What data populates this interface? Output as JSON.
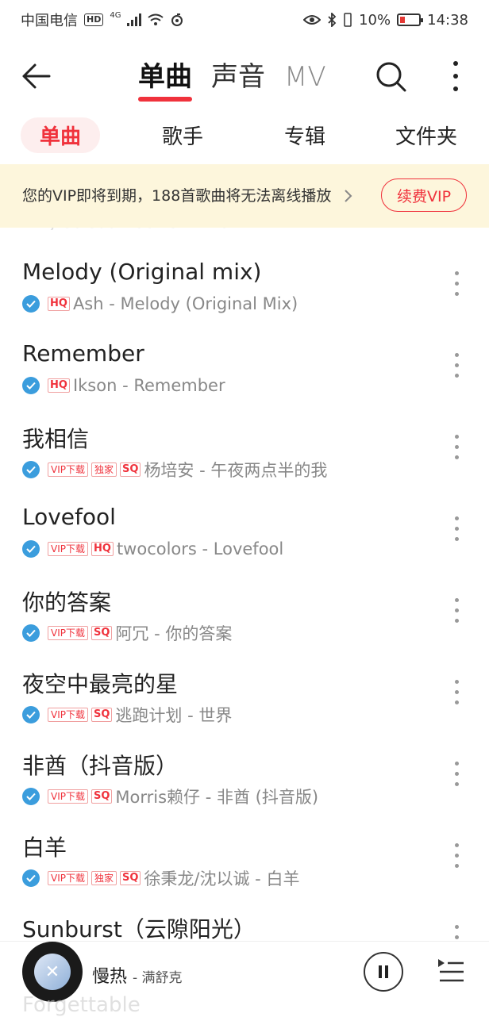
{
  "status_bar": {
    "carrier": "中国电信",
    "hd": "HD",
    "network": "4G",
    "battery_pct": "10%",
    "time": "14:38"
  },
  "top_nav": {
    "tabs": [
      "单曲",
      "声音",
      "MV"
    ],
    "active_tab": 0
  },
  "sub_tabs": {
    "items": [
      "单曲",
      "歌手",
      "专辑",
      "文件夹"
    ],
    "active": 0
  },
  "banner": {
    "text": "您的VIP即将到期，188首歌曲将无法离线播放",
    "button": "续费VIP"
  },
  "partial_row": {
    "text": "Why So Sad - Out Of Time"
  },
  "songs": [
    {
      "title": "Melody (Original mix)",
      "badges": [
        "HQ"
      ],
      "meta": "Ash - Melody (Original Mix)"
    },
    {
      "title": "Remember",
      "badges": [
        "HQ"
      ],
      "meta": "Ikson - Remember"
    },
    {
      "title": "我相信",
      "badges": [
        "VIP下载",
        "独家",
        "SQ"
      ],
      "meta": "杨培安 - 午夜两点半的我"
    },
    {
      "title": "Lovefool",
      "badges": [
        "VIP下载",
        "HQ"
      ],
      "meta": "twocolors - Lovefool"
    },
    {
      "title": "你的答案",
      "badges": [
        "VIP下载",
        "SQ"
      ],
      "meta": "阿冗 - 你的答案"
    },
    {
      "title": "夜空中最亮的星",
      "badges": [
        "VIP下载",
        "SQ"
      ],
      "meta": "逃跑计划 - 世界"
    },
    {
      "title": "非酋（抖音版）",
      "badges": [
        "VIP下载",
        "SQ"
      ],
      "meta": "Morris赖仔 - 非酋 (抖音版)"
    },
    {
      "title": "白羊",
      "badges": [
        "VIP下载",
        "独家",
        "SQ"
      ],
      "meta": "徐秉龙/沈以诚 - 白羊"
    },
    {
      "title": "Sunburst（云隙阳光）",
      "badges": [],
      "meta": ""
    }
  ],
  "player": {
    "title": "慢热",
    "artist": "- 满舒克"
  },
  "below_text": "Forgettable",
  "colors": {
    "accent": "#f0323c",
    "check": "#3b9ddd",
    "banner_bg": "#fdf6dc"
  }
}
